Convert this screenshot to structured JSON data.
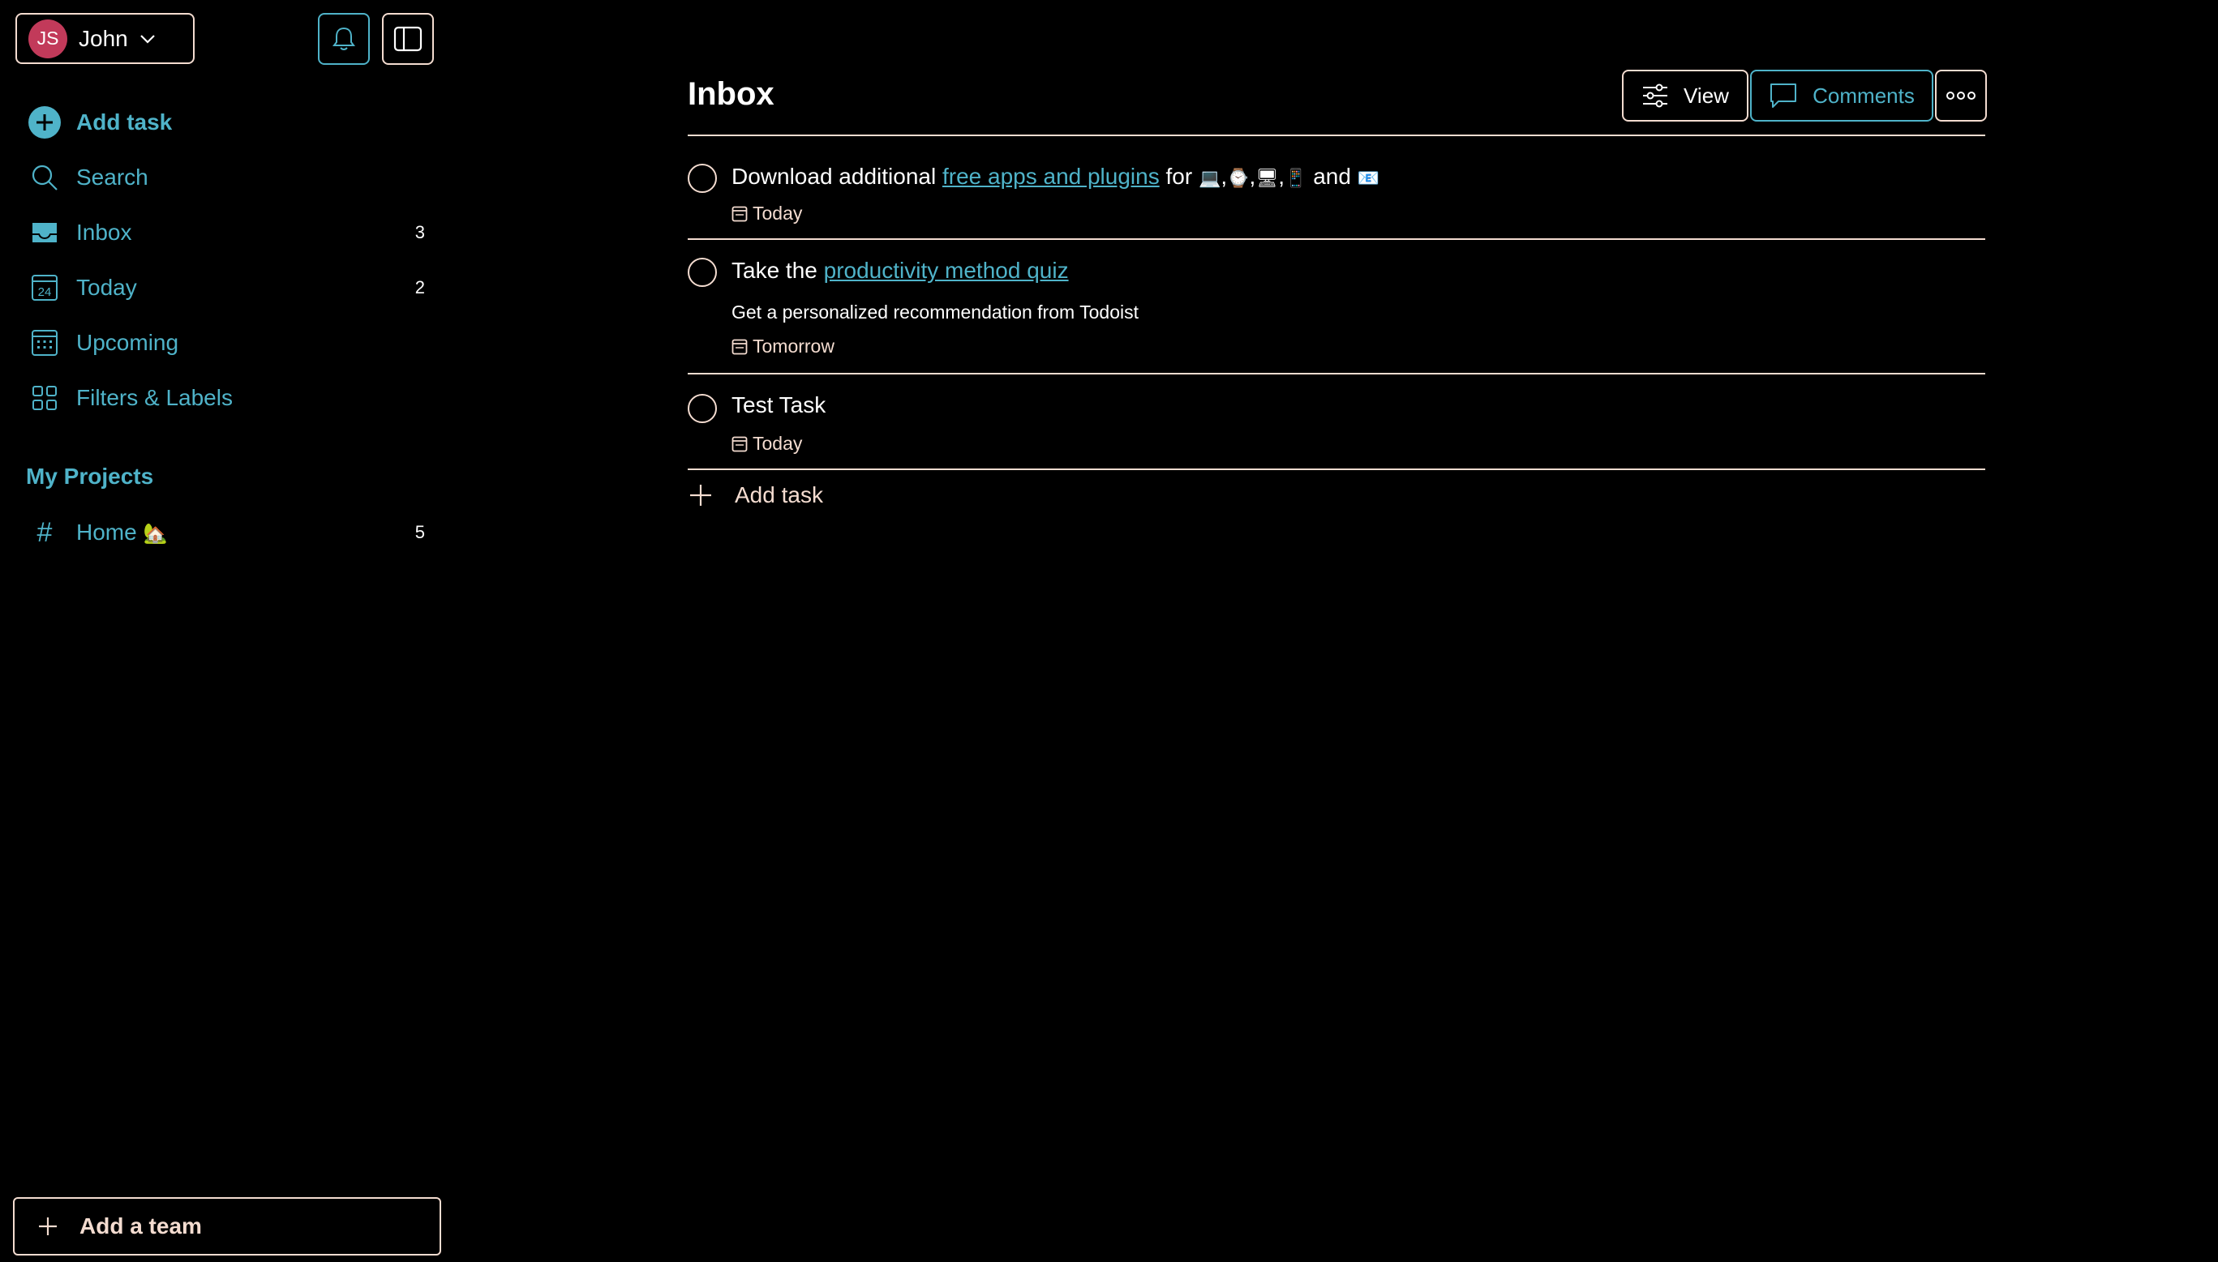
{
  "account": {
    "initials": "JS",
    "name": "John"
  },
  "nav": {
    "add_task": "Add task",
    "search": "Search",
    "inbox": {
      "label": "Inbox",
      "count": "3"
    },
    "today": {
      "label": "Today",
      "count": "2",
      "icon_day": "24"
    },
    "upcoming": "Upcoming",
    "filters": "Filters & Labels"
  },
  "projects": {
    "heading": "My Projects",
    "home": {
      "label": "Home",
      "emoji": "🏡",
      "count": "5"
    }
  },
  "team_button": "Add a team",
  "page": {
    "title": "Inbox",
    "view_label": "View",
    "comments_label": "Comments"
  },
  "tasks": [
    {
      "prefix": "Download additional ",
      "link": "free apps and plugins",
      "suffix": " for ",
      "emojis": [
        "💻",
        ",",
        "⌚",
        ",",
        "🖥",
        ",",
        "📱"
      ],
      "and": " and ",
      "last_emoji": "📧",
      "date": "Today"
    },
    {
      "prefix": "Take the ",
      "link": "productivity method quiz",
      "description": "Get a personalized recommendation from Todoist",
      "date": "Tomorrow"
    },
    {
      "title": "Test Task",
      "date": "Today"
    }
  ],
  "add_task_label": "Add task",
  "colors": {
    "accent": "#4fb3c9",
    "border": "#f4dcd0",
    "avatar": "#c23a5a",
    "background": "#000000"
  }
}
